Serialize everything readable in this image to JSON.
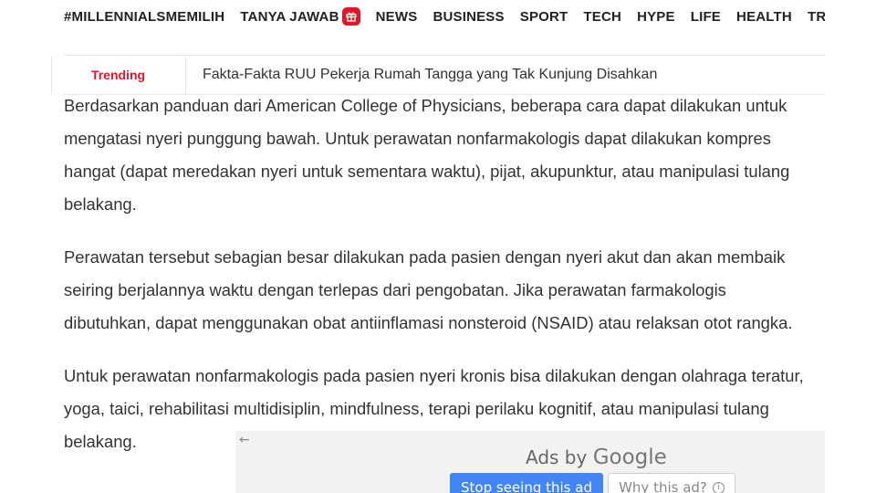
{
  "nav": {
    "items": [
      {
        "label": "#MILLENNIALSMEMILIH"
      },
      {
        "label": "TANYA JAWAB"
      },
      {
        "label": "NEWS"
      },
      {
        "label": "BUSINESS"
      },
      {
        "label": "SPORT"
      },
      {
        "label": "TECH"
      },
      {
        "label": "HYPE"
      },
      {
        "label": "LIFE"
      },
      {
        "label": "HEALTH"
      },
      {
        "label": "TRAVEL"
      }
    ],
    "badge_icon": "gift-icon",
    "accent_color": "#e0162b"
  },
  "trending": {
    "label": "Trending",
    "headline": "Fakta-Fakta RUU Pekerja Rumah Tangga yang Tak Kunjung Disahkan"
  },
  "article": {
    "paragraphs": [
      "Berdasarkan panduan dari American College of Physicians, beberapa cara dapat dilakukan untuk mengatasi nyeri punggung bawah. Untuk perawatan nonfarmakologis dapat dilakukan kompres hangat (dapat meredakan nyeri untuk sementara waktu), pijat, akupunktur, atau manipulasi tulang belakang.",
      "Perawatan tersebut sebagian besar dilakukan pada pasien dengan nyeri akut dan akan membaik seiring berjalannya waktu dengan terlepas dari pengobatan. Jika perawatan farmakologis dibutuhkan, dapat menggunakan obat antiinflamasi nonsteroid (NSAID) atau relaksan otot rangka.",
      "Untuk perawatan nonfarmakologis pada pasien nyeri kronis bisa dilakukan dengan olahraga teratur, yoga, taici, rehabilitasi multidisiplin, mindfulness, terapi perilaku kognitif, atau manipulasi tulang belakang."
    ]
  },
  "ad": {
    "back_arrow": "←",
    "title_prefix": "Ads by ",
    "title_brand": "Google",
    "stop_label": "Stop seeing this ad",
    "why_label": "Why this ad?",
    "info_icon": "ⓘ",
    "button_color": "#4285f4"
  }
}
